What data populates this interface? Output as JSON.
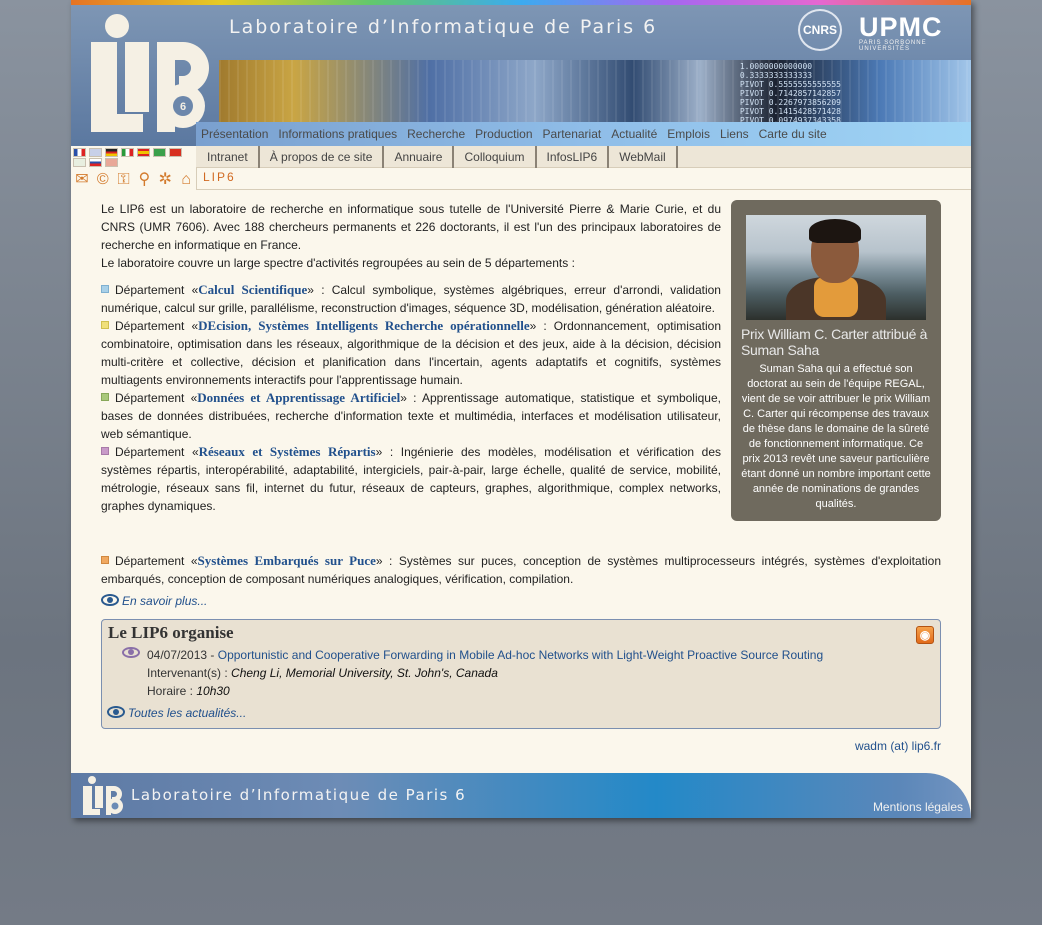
{
  "header": {
    "title": "Laboratoire d’Informatique de Paris 6",
    "logo_text": "LIP6",
    "cnrs_logo": "CNRS",
    "upmc_logo": "UPMC",
    "upmc_sub": "PARIS SORBONNE UNIVERSITÉS",
    "banner_code": "1.0000000000000\n0.3333333333333\nPIVOT 0.5555555555555\nPIVOT 0.7142857142857\nPIVOT 0.2267973856209\nPIVOT 0.1415428571428\nPIVOT 0.0974937343358"
  },
  "nav_main": [
    "Présentation",
    "Informations pratiques",
    "Recherche",
    "Production",
    "Partenariat",
    "Actualité",
    "Emplois",
    "Liens",
    "Carte du site"
  ],
  "nav_sub": [
    "Intranet",
    "À propos de ce site",
    "Annuaire",
    "Colloquium",
    "InfosLIP6",
    "WebMail"
  ],
  "breadcrumb": "LIP6",
  "tools": {
    "mail": "✉",
    "copyright": "©",
    "key": "⚿",
    "search": "⚲",
    "settings": "✲",
    "home": "⌂"
  },
  "intro": {
    "p1": "Le LIP6 est un laboratoire de recherche en informatique sous tutelle de l'Université Pierre & Marie Curie, et du CNRS (UMR 7606). Avec 188 chercheurs permanents et 226 doctorants, il est l'un des principaux laboratoires de recherche en informatique en France.",
    "p2": "Le laboratoire couvre un large spectre d'activités regroupées au sein de 5 départements :"
  },
  "departments": [
    {
      "prefix": "Département «",
      "name": "Calcul Scientifique",
      "desc": "» : Calcul symbolique, systèmes algébriques, erreur d'arrondi, validation numérique, calcul sur grille, parallélisme, reconstruction d'images, séquence 3D, modélisation, génération aléatoire.",
      "color": "#a8d0e8"
    },
    {
      "prefix": "Département «",
      "name": "DEcision, Systèmes Intelligents Recherche opérationnelle",
      "desc": "» : Ordonnancement, optimisation combinatoire, optimisation dans les réseaux, algorithmique de la décision et des jeux, aide à la décision, décision multi-critère et collective, décision et planification dans l'incertain, agents adaptatifs et cognitifs, systèmes multiagents environnements interactifs pour l'apprentissage humain.",
      "color": "#f0e07a"
    },
    {
      "prefix": "Département «",
      "name": "Données et Apprentissage Artificiel",
      "desc": "» : Apprentissage automatique, statistique et symbolique, bases de données distribuées, recherche d'information texte et multimédia, interfaces et modélisation utilisateur, web sémantique.",
      "color": "#a8c87a"
    },
    {
      "prefix": "Département «",
      "name": "Réseaux et Systèmes Répartis",
      "desc": "» : Ingénierie des modèles, modélisation et vérification des systèmes répartis, interopérabilité, adaptabilité, intergiciels, pair-à-pair, large échelle, qualité de service, mobilité, métrologie, réseaux sans fil, internet du futur, réseaux de capteurs, graphes, algorithmique, complex networks, graphes dynamiques.",
      "color": "#c89ac8"
    },
    {
      "prefix": "Département «",
      "name": "Systèmes Embarqués sur Puce",
      "desc": "» : Systèmes sur puces, conception de systèmes multiprocesseurs intégrés, systèmes d'exploitation embarqués, conception de composant numériques analogiques, vérification, compilation.",
      "color": "#f0a860"
    }
  ],
  "en_savoir_plus": "En savoir plus...",
  "news": {
    "title": "Prix William C. Carter attribué à Suman Saha",
    "text": "Suman Saha qui a effectué son doctorat au sein de l'équipe REGAL, vient de se voir attribuer le prix William C. Carter qui récompense des travaux de thèse dans le domaine de la sûreté de fonctionnement informatique. Ce prix 2013 revêt une saveur particulière étant donné un nombre important cette année de nominations de grandes qualités."
  },
  "organise": {
    "title": "Le LIP6 organise",
    "date": "04/07/2013 - ",
    "event_title": "Opportunistic and Cooperative Forwarding in Mobile Ad-hoc Networks with Light-Weight Proactive Source Routing",
    "speaker_label": "Intervenant(s) : ",
    "speaker": "Cheng Li, Memorial University, St. John's, Canada",
    "time_label": "Horaire : ",
    "time": "10h30",
    "all_news": "Toutes les actualités...",
    "rss_icon": "rss-icon"
  },
  "contact": "wadm (at) lip6.fr",
  "footer": {
    "title": "Laboratoire d’Informatique de Paris 6",
    "mentions": "Mentions légales"
  }
}
